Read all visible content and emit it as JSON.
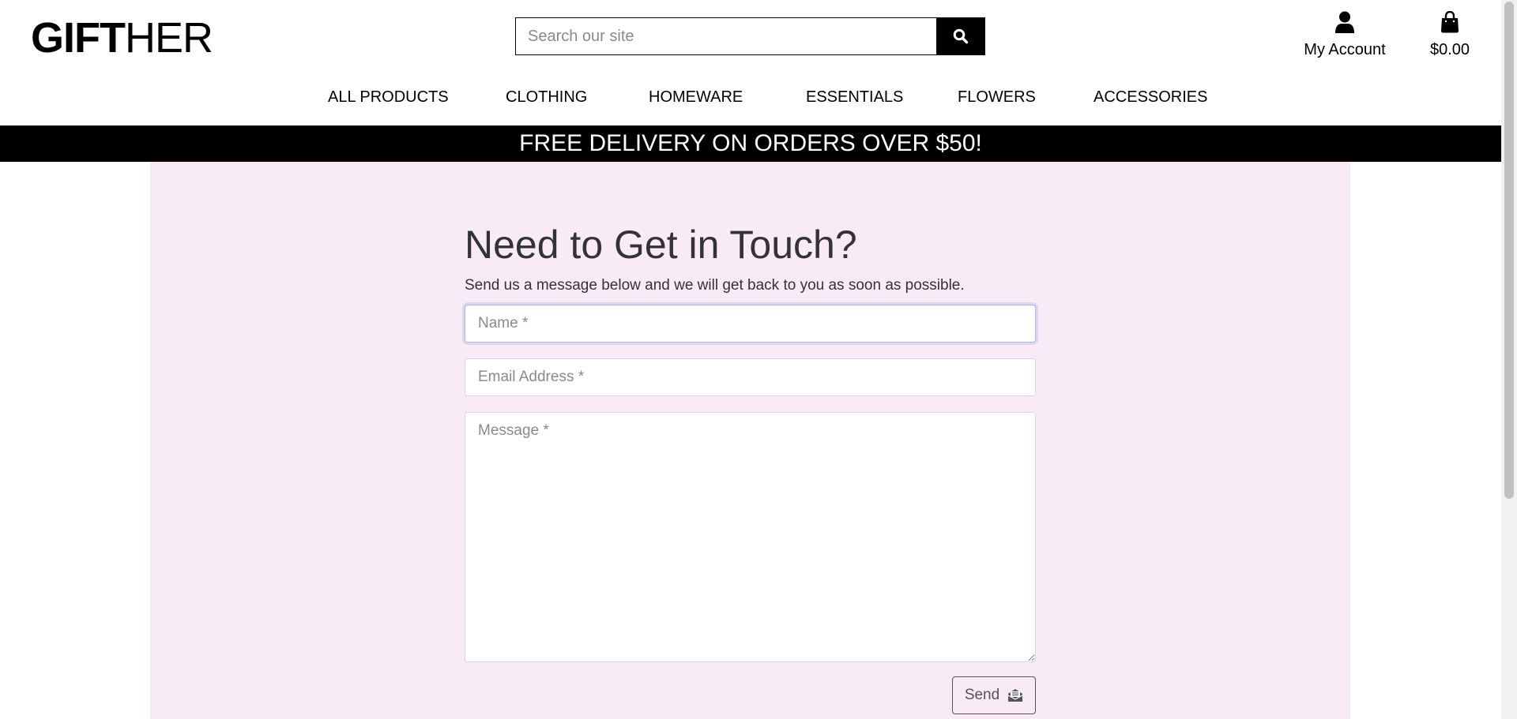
{
  "header": {
    "logo_bold": "GIFT",
    "logo_light": "HER",
    "search": {
      "placeholder": "Search our site",
      "value": ""
    },
    "account_label": "My Account",
    "bag_total": "$0.00"
  },
  "nav": {
    "items": [
      {
        "label": "ALL PRODUCTS"
      },
      {
        "label": "CLOTHING"
      },
      {
        "label": "HOMEWARE"
      },
      {
        "label": "ESSENTIALS"
      },
      {
        "label": "FLOWERS"
      },
      {
        "label": "ACCESSORIES"
      }
    ]
  },
  "banner": {
    "text": "FREE DELIVERY ON ORDERS OVER $50!"
  },
  "contact": {
    "title": "Need to Get in Touch?",
    "subtitle": "Send us a message below and we will get back to you as soon as possible.",
    "name_placeholder": "Name *",
    "email_placeholder": "Email Address *",
    "message_placeholder": "Message *",
    "send_label": "Send"
  },
  "colors": {
    "content_bg": "#f8ebf5",
    "banner_bg": "#000000",
    "banner_text": "#ffffff",
    "focus_ring": "#aab8e8"
  },
  "icons": {
    "search": "search-icon",
    "account": "user-icon",
    "bag": "shopping-bag-icon",
    "send": "envelope-open-icon"
  }
}
